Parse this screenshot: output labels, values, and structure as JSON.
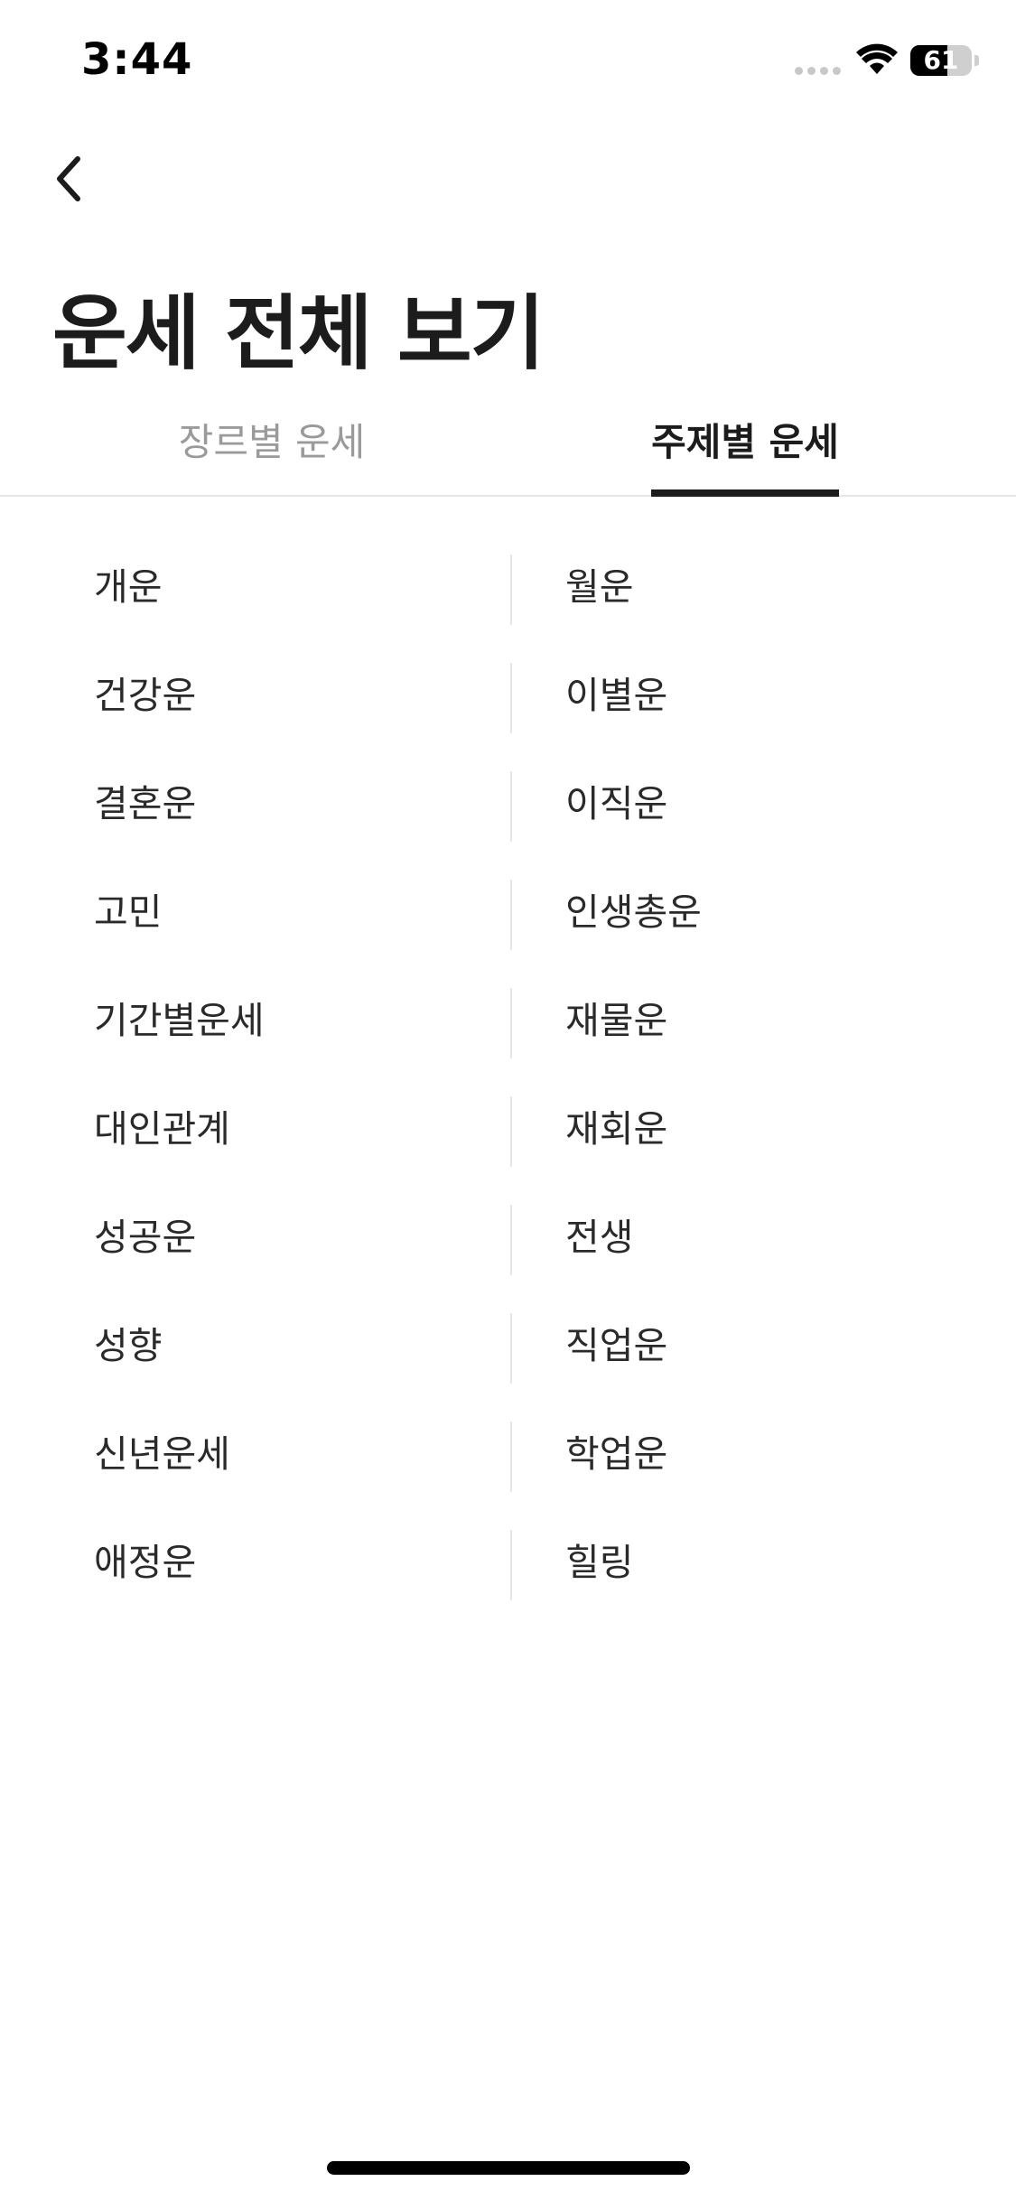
{
  "status_bar": {
    "time": "3:44",
    "battery_level": "61",
    "battery_percent": 61,
    "icons": [
      "signal-dots-icon",
      "wifi-icon",
      "battery-icon"
    ]
  },
  "header": {
    "back_icon": "chevron-left-icon",
    "title": "운세 전체 보기"
  },
  "tabs": [
    {
      "label": "장르별 운세",
      "active": false
    },
    {
      "label": "주제별 운세",
      "active": true
    }
  ],
  "list": {
    "left": [
      "개운",
      "건강운",
      "결혼운",
      "고민",
      "기간별운세",
      "대인관계",
      "성공운",
      "성향",
      "신년운세",
      "애정운"
    ],
    "right": [
      "월운",
      "이별운",
      "이직운",
      "인생총운",
      "재물운",
      "재회운",
      "전생",
      "직업운",
      "학업운",
      "힐링"
    ]
  },
  "colors": {
    "text_primary": "#1c1c1c",
    "text_inactive": "#9a9a9a",
    "divider": "#e6e6e6",
    "background": "#ffffff"
  }
}
